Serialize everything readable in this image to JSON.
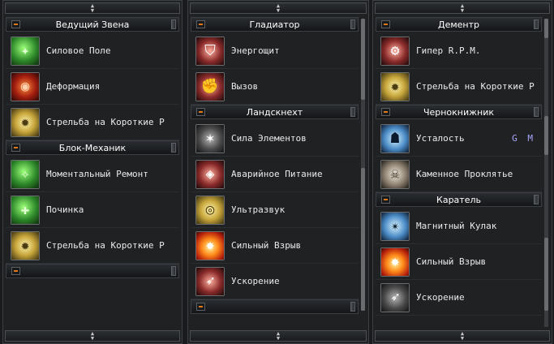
{
  "panels": [
    {
      "groups": [
        {
          "title": "Ведущий Звена",
          "skills": [
            {
              "label": "Силовое Поле",
              "icon": "force-field-icon"
            },
            {
              "label": "Деформация",
              "icon": "deformation-icon"
            },
            {
              "label": "Стрельба на Короткие Р",
              "icon": "short-range-shot-icon"
            }
          ]
        },
        {
          "title": "Блок-Механик",
          "skills": [
            {
              "label": "Моментальный Ремонт",
              "icon": "instant-repair-icon"
            },
            {
              "label": "Починка",
              "icon": "repair-icon"
            },
            {
              "label": "Стрельба на Короткие Р",
              "icon": "short-range-shot-icon"
            }
          ]
        }
      ]
    },
    {
      "groups": [
        {
          "title": "Гладиатор",
          "skills": [
            {
              "label": "Энергощит",
              "icon": "energy-shield-icon"
            },
            {
              "label": "Вызов",
              "icon": "challenge-icon"
            }
          ]
        },
        {
          "title": "Ландскнехт",
          "skills": [
            {
              "label": "Сила Элементов",
              "icon": "element-power-icon"
            },
            {
              "label": "Аварийное Питание",
              "icon": "emergency-power-icon"
            },
            {
              "label": "Ультразвук",
              "icon": "ultrasound-icon"
            },
            {
              "label": "Сильный Взрыв",
              "icon": "big-explosion-icon"
            },
            {
              "label": "Ускорение",
              "icon": "acceleration-icon"
            }
          ]
        }
      ]
    },
    {
      "groups": [
        {
          "title": "Дементр",
          "skills": [
            {
              "label": "Гипер R.P.M.",
              "icon": "hyper-rpm-icon"
            },
            {
              "label": "Стрельба на Короткие Р",
              "icon": "short-range-shot-icon"
            }
          ]
        },
        {
          "title": "Чернокнижник",
          "skills": [
            {
              "label": "Усталость",
              "icon": "fatigue-icon",
              "badge": "G M"
            },
            {
              "label": "Каменное Проклятье",
              "icon": "stone-curse-icon"
            }
          ]
        },
        {
          "title": "Каратель",
          "skills": [
            {
              "label": "Магнитный Кулак",
              "icon": "magnetic-fist-icon"
            },
            {
              "label": "Сильный Взрыв",
              "icon": "big-explosion-icon"
            },
            {
              "label": "Ускорение",
              "icon": "acceleration-icon"
            }
          ]
        }
      ]
    }
  ],
  "colors": {
    "accent_orange": "#e07a1c",
    "gm_badge": "#a8a8ff"
  }
}
